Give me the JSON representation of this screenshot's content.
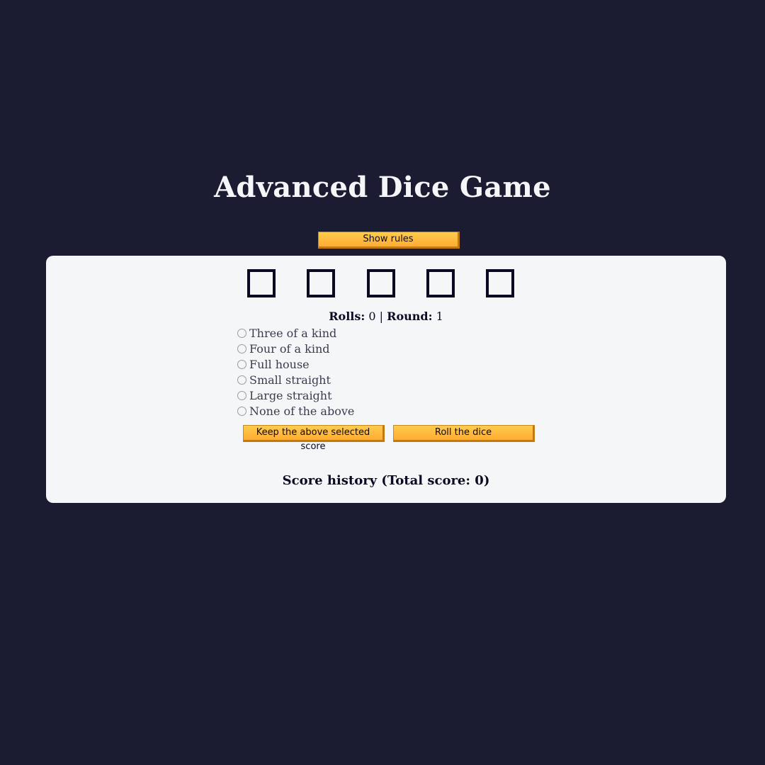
{
  "title": "Advanced Dice Game",
  "rules_button": "Show rules",
  "status": {
    "rolls_label": "Rolls:",
    "rolls_value": "0",
    "separator": "|",
    "round_label": "Round:",
    "round_value": "1"
  },
  "score_options": [
    {
      "label": "Three of a kind",
      "selected": false
    },
    {
      "label": "Four of a kind",
      "selected": false
    },
    {
      "label": "Full house",
      "selected": false
    },
    {
      "label": "Small straight",
      "selected": false
    },
    {
      "label": "Large straight",
      "selected": false
    },
    {
      "label": "None of the above",
      "selected": false
    }
  ],
  "keep_button": "Keep the above selected score",
  "roll_button": "Roll the dice",
  "history_title": "Score history (Total score: 0)",
  "colors": {
    "background": "#1b1b32",
    "card": "#f5f6f7",
    "button": "#feac32"
  }
}
